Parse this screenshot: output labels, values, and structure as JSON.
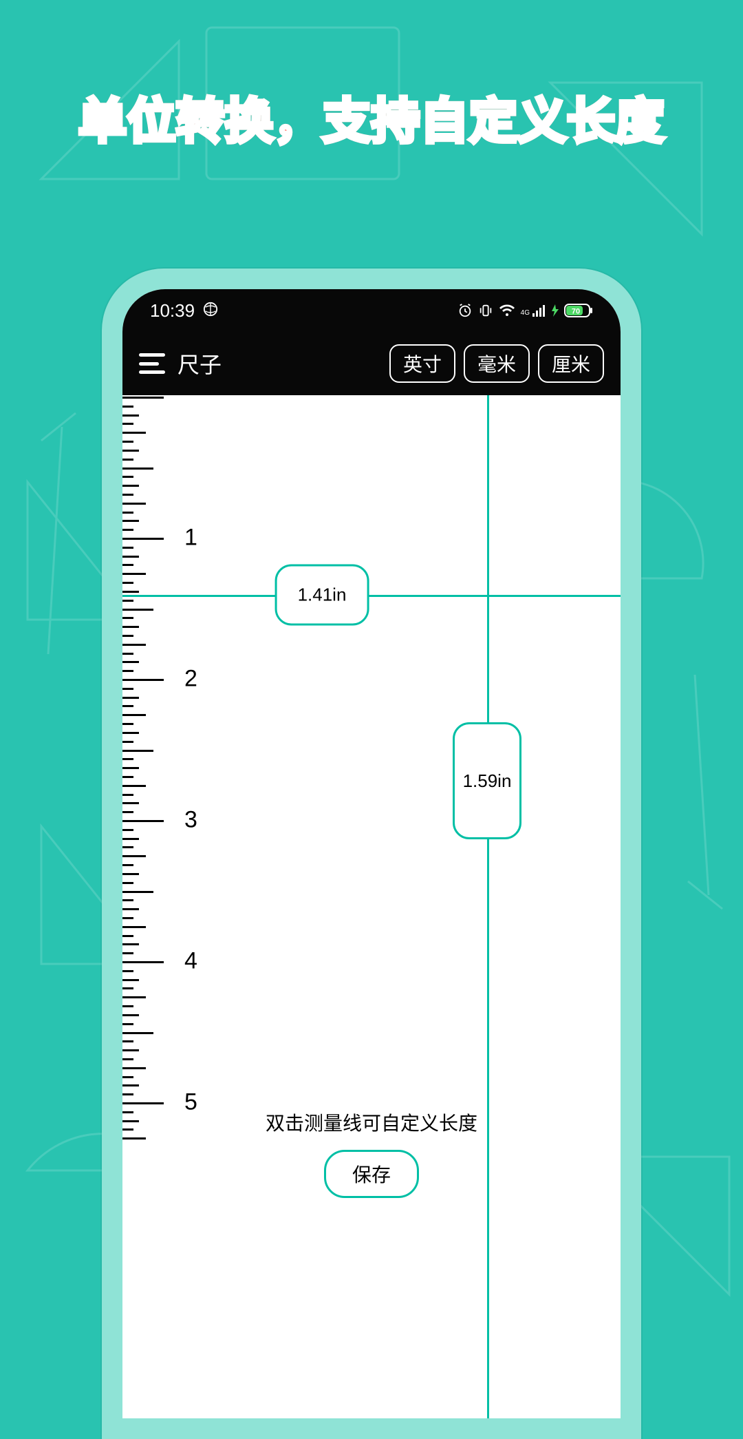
{
  "headline": "单位转换，支持自定义长度",
  "status": {
    "time": "10:39",
    "battery": "70"
  },
  "appbar": {
    "title": "尺子",
    "units": [
      "英寸",
      "毫米",
      "厘米"
    ]
  },
  "ruler": {
    "labels": [
      "1",
      "2",
      "3",
      "4",
      "5"
    ]
  },
  "measure": {
    "h_value": "1.41in",
    "v_value": "1.59in"
  },
  "hint": "双击测量线可自定义长度",
  "save_label": "保存",
  "colors": {
    "bg": "#29c3b0",
    "accent": "#00bfa5"
  }
}
